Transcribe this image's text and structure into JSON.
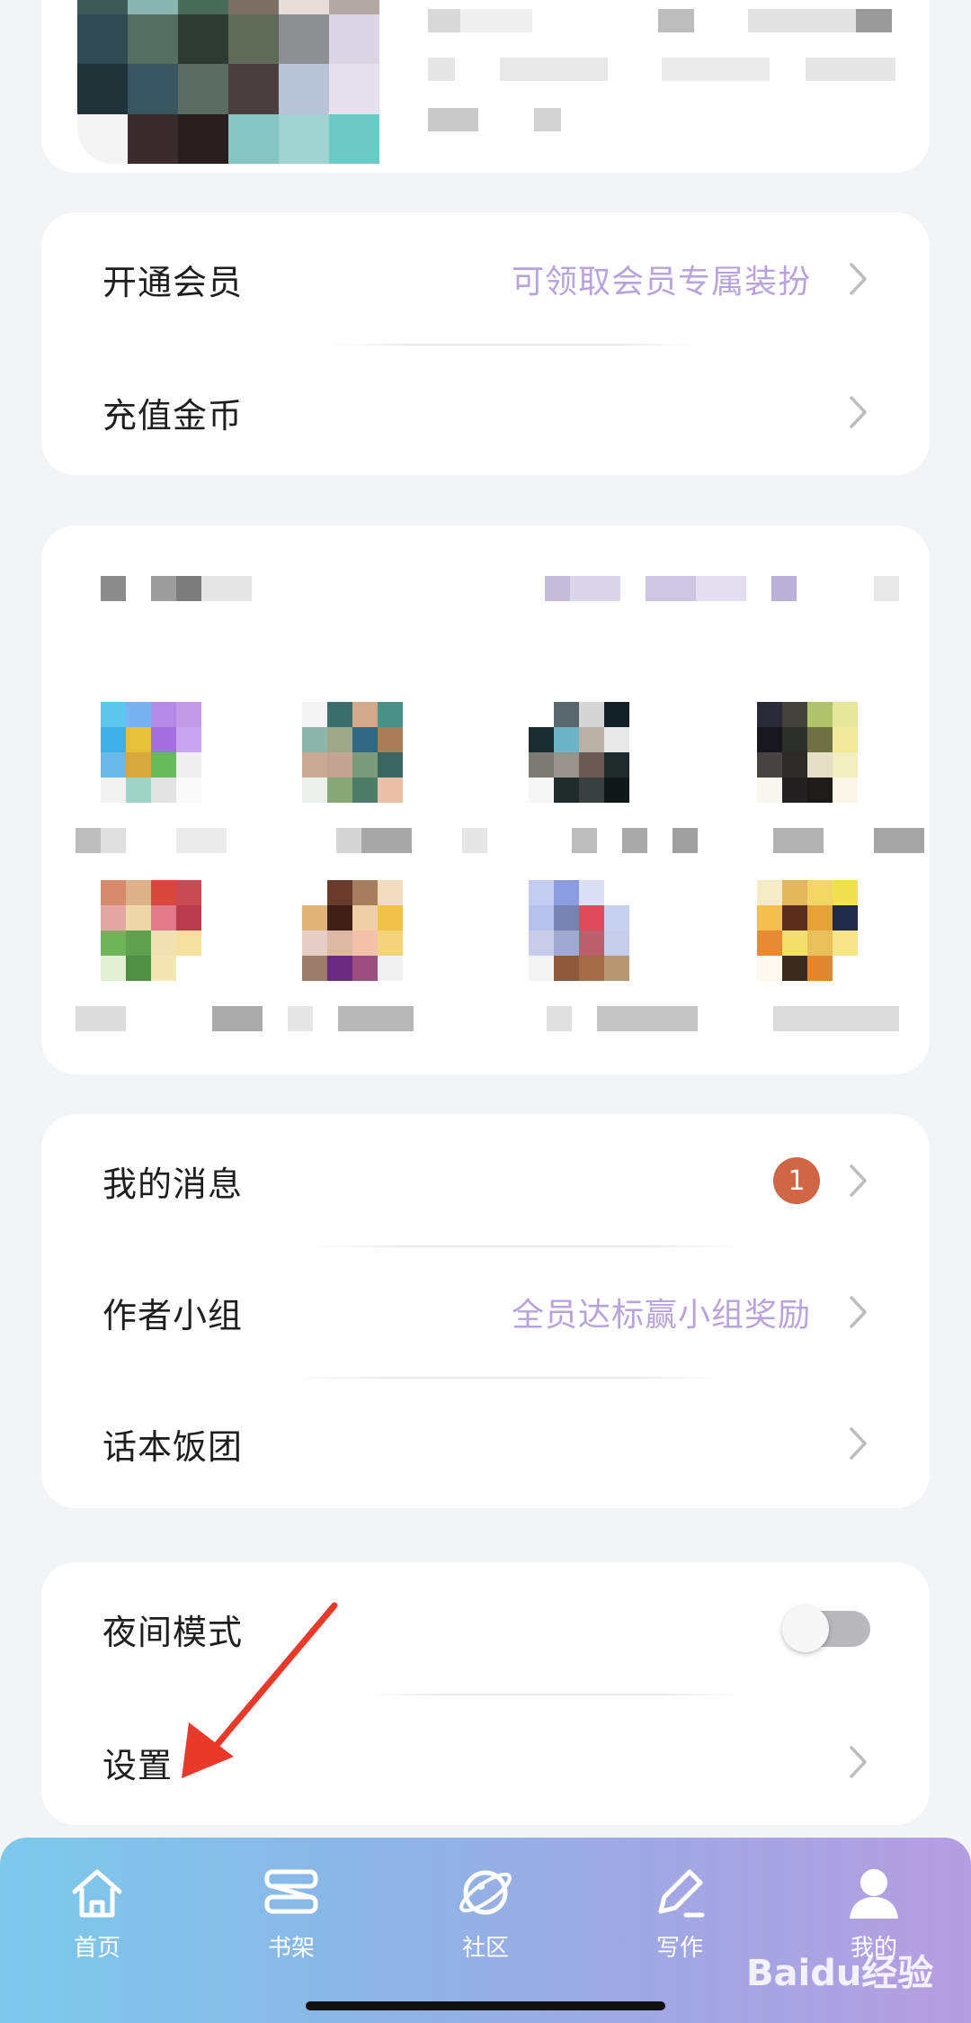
{
  "membership_card": {
    "vip": {
      "label": "开通会员",
      "hint": "可领取会员专属装扮"
    },
    "coins": {
      "label": "充值金币"
    }
  },
  "menu_card": {
    "messages": {
      "label": "我的消息",
      "badge": "1"
    },
    "author_group": {
      "label": "作者小组",
      "hint": "全员达标赢小组奖励"
    },
    "fan_group": {
      "label": "话本饭团"
    }
  },
  "settings_card": {
    "night_mode": {
      "label": "夜间模式",
      "enabled": false
    },
    "settings": {
      "label": "设置"
    }
  },
  "tabbar": {
    "tabs": [
      {
        "label": "首页",
        "icon": "home-icon"
      },
      {
        "label": "书架",
        "icon": "bookshelf-icon"
      },
      {
        "label": "社区",
        "icon": "planet-icon"
      },
      {
        "label": "写作",
        "icon": "pen-icon"
      },
      {
        "label": "我的",
        "icon": "user-icon",
        "active": true
      }
    ]
  },
  "watermark": {
    "text": "Baidu经验"
  },
  "colors": {
    "hint": "#b7a4dc",
    "badge": "#d06645",
    "tabbar_start": "#7cc9ec",
    "tabbar_end": "#b59ee2"
  }
}
